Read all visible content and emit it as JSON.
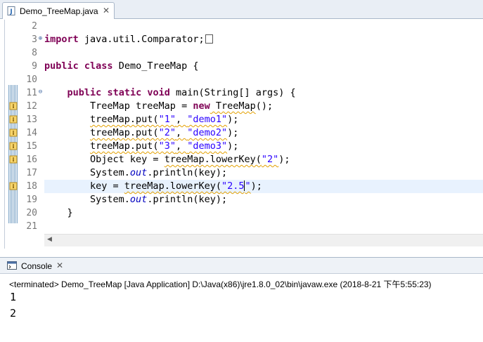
{
  "editor_tab": {
    "label": "Demo_TreeMap.java",
    "close": "✕"
  },
  "gutter": {
    "line_numbers": [
      "2",
      "3",
      "8",
      "9",
      "10",
      "11",
      "12",
      "13",
      "14",
      "15",
      "16",
      "17",
      "18",
      "19",
      "20",
      "21"
    ]
  },
  "code": {
    "l3_import": "import",
    "l3_rest": " java.util.Comparator;",
    "l9_public": "public",
    "l9_class": "class",
    "l9_rest": " Demo_TreeMap {",
    "l11_indent": "    ",
    "l11_public": "public",
    "l11_static": "static",
    "l11_void": "void",
    "l11_rest": " main(String[] args) {",
    "l12_a": "        TreeMap treeMap = ",
    "l12_new": "new",
    "l12_b": " TreeMap",
    "l12_c": "();",
    "l13_a": "        ",
    "l13_b": "treeMap.put(",
    "l13_s1": "\"1\"",
    "l13_comma": ", ",
    "l13_s2": "\"demo1\"",
    "l13_end": ");",
    "l14_a": "        ",
    "l14_b": "treeMap.put(",
    "l14_s1": "\"2\"",
    "l14_comma": ", ",
    "l14_s2": "\"demo2\"",
    "l14_end": ");",
    "l15_a": "        ",
    "l15_b": "treeMap.put(",
    "l15_s1": "\"3\"",
    "l15_comma": ", ",
    "l15_s2": "\"demo3\"",
    "l15_end": ");",
    "l16_a": "        Object key = ",
    "l16_b": "treeMap.lowerKey(",
    "l16_s": "\"2\"",
    "l16_end": ");",
    "l17_a": "        System.",
    "l17_out": "out",
    "l17_b": ".println(key);",
    "l18_a": "        key = ",
    "l18_b": "treeMap.lowerKey(",
    "l18_s1": "\"2.5",
    "l18_s2": "\"",
    "l18_end": ");",
    "l19_a": "        System.",
    "l19_out": "out",
    "l19_b": ".println(key);",
    "l20": "    }"
  },
  "console": {
    "tab_label": "Console",
    "close": "✕",
    "status": "<terminated> Demo_TreeMap [Java Application] D:\\Java(x86)\\jre1.8.0_02\\bin\\javaw.exe (2018-8-21 下午5:55:23)",
    "output": [
      "1",
      "2"
    ]
  },
  "colors": {
    "keyword": "#7f0055",
    "string": "#2a00ff",
    "static_field": "#0000c0",
    "current_line": "#e8f2fe",
    "warning_underline": "#e3a000"
  }
}
